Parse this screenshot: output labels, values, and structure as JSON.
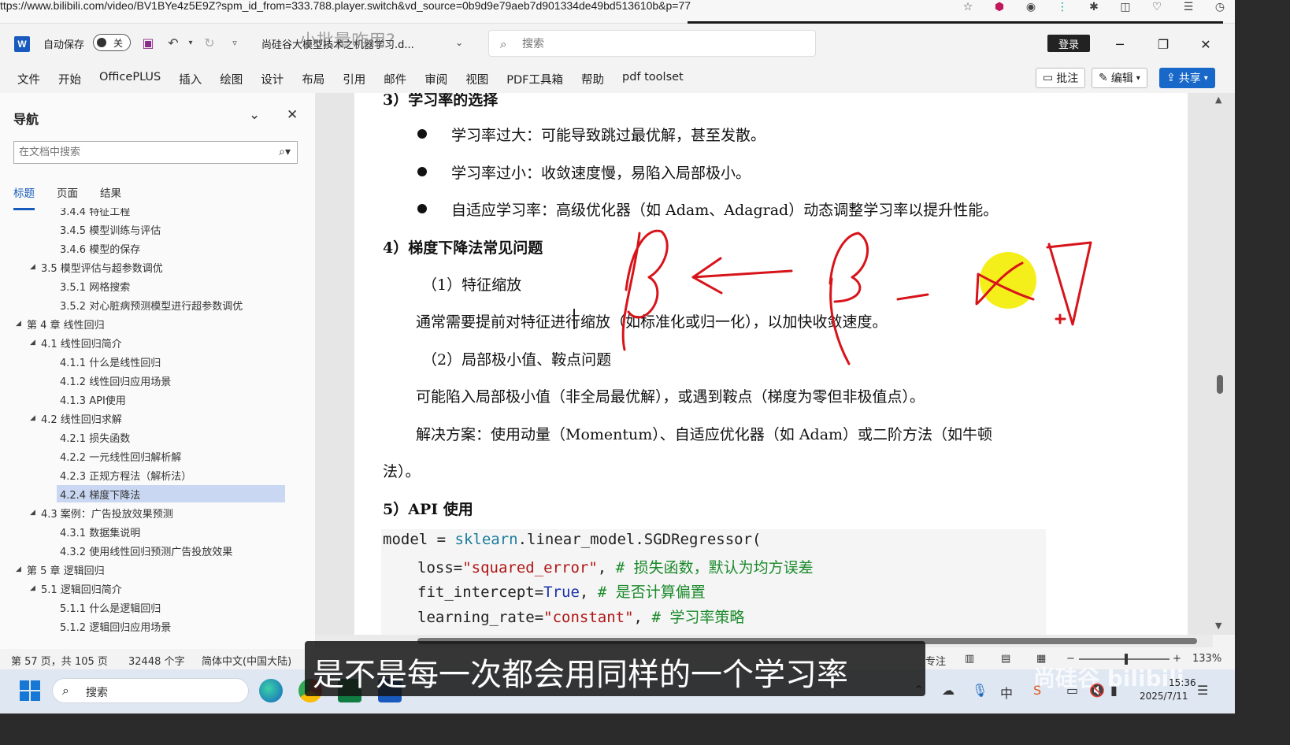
{
  "browser": {
    "url": "ttps://www.bilibili.com/video/BV1BYe4z5E9Z?spm_id_from=333.788.player.switch&vd_source=0b9d9e79aeb7d901334de49bd513610b&p=77"
  },
  "word": {
    "autosave_label": "自动保存",
    "autosave_state": "关",
    "doc_name": "尚硅谷大模型技术之机器学习.d...",
    "overlay_title": "小批量咋用?",
    "search_placeholder": "搜索",
    "login_label": "登录",
    "menu": [
      "文件",
      "开始",
      "OfficePLUS",
      "插入",
      "绘图",
      "设计",
      "布局",
      "引用",
      "邮件",
      "审阅",
      "视图",
      "PDF工具箱",
      "帮助",
      "pdf toolset"
    ],
    "comment_label": "批注",
    "edit_label": "编辑",
    "share_label": "共享"
  },
  "nav": {
    "title": "导航",
    "search_placeholder": "在文档中搜索",
    "tabs": [
      "标题",
      "页面",
      "结果"
    ],
    "active_tab": 0,
    "items": [
      {
        "label": "3.4.4 特征工程",
        "level": 3,
        "expand": false,
        "selected": false
      },
      {
        "label": "3.4.5 模型训练与评估",
        "level": 3,
        "expand": false,
        "selected": false
      },
      {
        "label": "3.4.6 模型的保存",
        "level": 3,
        "expand": false,
        "selected": false
      },
      {
        "label": "3.5 模型评估与超参数调优",
        "level": 2,
        "expand": true,
        "selected": false
      },
      {
        "label": "3.5.1 网格搜索",
        "level": 3,
        "expand": false,
        "selected": false
      },
      {
        "label": "3.5.2 对心脏病预测模型进行超参数调优",
        "level": 3,
        "expand": false,
        "selected": false
      },
      {
        "label": "第 4 章 线性回归",
        "level": 1,
        "expand": true,
        "selected": false
      },
      {
        "label": "4.1 线性回归简介",
        "level": 2,
        "expand": true,
        "selected": false
      },
      {
        "label": "4.1.1 什么是线性回归",
        "level": 3,
        "expand": false,
        "selected": false
      },
      {
        "label": "4.1.2 线性回归应用场景",
        "level": 3,
        "expand": false,
        "selected": false
      },
      {
        "label": "4.1.3 API使用",
        "level": 3,
        "expand": false,
        "selected": false
      },
      {
        "label": "4.2 线性回归求解",
        "level": 2,
        "expand": true,
        "selected": false
      },
      {
        "label": "4.2.1 损失函数",
        "level": 3,
        "expand": false,
        "selected": false
      },
      {
        "label": "4.2.2 一元线性回归解析解",
        "level": 3,
        "expand": false,
        "selected": false
      },
      {
        "label": "4.2.3 正规方程法（解析法）",
        "level": 3,
        "expand": false,
        "selected": false
      },
      {
        "label": "4.2.4 梯度下降法",
        "level": 3,
        "expand": false,
        "selected": true
      },
      {
        "label": "4.3 案例：广告投放效果预测",
        "level": 2,
        "expand": true,
        "selected": false
      },
      {
        "label": "4.3.1 数据集说明",
        "level": 3,
        "expand": false,
        "selected": false
      },
      {
        "label": "4.3.2 使用线性回归预测广告投放效果",
        "level": 3,
        "expand": false,
        "selected": false
      },
      {
        "label": "第 5 章 逻辑回归",
        "level": 1,
        "expand": true,
        "selected": false
      },
      {
        "label": "5.1 逻辑回归简介",
        "level": 2,
        "expand": true,
        "selected": false
      },
      {
        "label": "5.1.1 什么是逻辑回归",
        "level": 3,
        "expand": false,
        "selected": false
      },
      {
        "label": "5.1.2 逻辑回归应用场景",
        "level": 3,
        "expand": false,
        "selected": false
      }
    ]
  },
  "doc": {
    "h3": "3）学习率的选择",
    "b1": "学习率过大：可能导致跳过最优解，甚至发散。",
    "b2": "学习率过小：收敛速度慢，易陷入局部极小。",
    "b3": "自适应学习率：高级优化器（如 Adam、Adagrad）动态调整学习率以提升性能。",
    "h4": "4）梯度下降法常见问题",
    "s1": "（1）特征缩放",
    "p1": "通常需要提前对特征进行缩放（如标准化或归一化），以加快收敛速度。",
    "s2": "（2）局部极小值、鞍点问题",
    "p2": "可能陷入局部极小值（非全局最优解），或遇到鞍点（梯度为零但非极值点）。",
    "p3a": "解决方案：使用动量（Momentum）、自适应优化器（如 Adam）或二阶方法（如牛顿",
    "p3b": "法）。",
    "h5": "5）API 使用",
    "code": {
      "l1_a": "model",
      "l1_b": " = ",
      "l1_c": "sklearn",
      "l1_d": ".linear_model.SGDRegressor(",
      "l2_a": "loss=",
      "l2_b": "\"squared_error\"",
      "l2_c": ",  ",
      "l2_d": "# 损失函数，默认为均方误差",
      "l3_a": "fit_intercept=",
      "l3_b": "True",
      "l3_c": ",  ",
      "l3_d": "# 是否计算偏置",
      "l4_a": "learning_rate=",
      "l4_b": "\"constant\"",
      "l4_c": ",  ",
      "l4_d": "# 学习率策略"
    }
  },
  "status": {
    "page": "第 57 页，共 105 页",
    "words": "32448 个字",
    "lang": "简体中文(中国大陆)",
    "focus": "专注",
    "zoom": "133%"
  },
  "taskbar": {
    "search_label": "搜索",
    "time": "15:36",
    "date": "2025/7/11",
    "watermark": "尚硅谷 bilibili"
  },
  "subtitle": "是不是每一次都会用同样的一个学习率"
}
